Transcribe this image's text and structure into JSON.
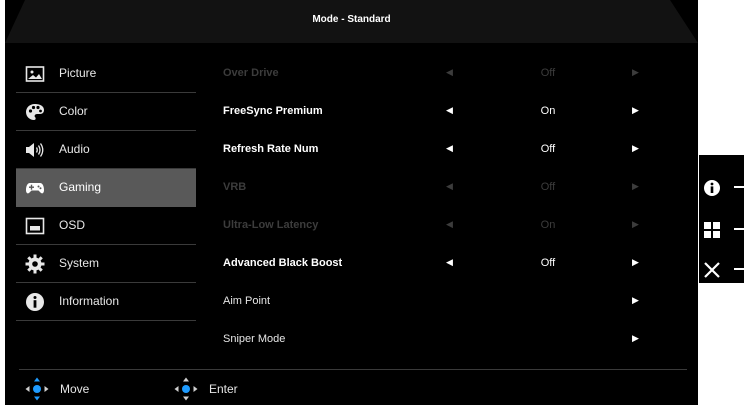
{
  "header": {
    "title": "Mode - Standard"
  },
  "sidebar": {
    "items": [
      {
        "label": "Picture",
        "icon": "picture-icon",
        "active": false
      },
      {
        "label": "Color",
        "icon": "palette-icon",
        "active": false
      },
      {
        "label": "Audio",
        "icon": "speaker-icon",
        "active": false
      },
      {
        "label": "Gaming",
        "icon": "gamepad-icon",
        "active": true
      },
      {
        "label": "OSD",
        "icon": "osd-icon",
        "active": false
      },
      {
        "label": "System",
        "icon": "gear-icon",
        "active": false
      },
      {
        "label": "Information",
        "icon": "info-icon",
        "active": false
      }
    ]
  },
  "menu": {
    "rows": [
      {
        "name": "Over Drive",
        "value": "Off",
        "enabled": false,
        "left_arrow": true
      },
      {
        "name": "FreeSync Premium",
        "value": "On",
        "enabled": true,
        "left_arrow": true
      },
      {
        "name": "Refresh Rate Num",
        "value": "Off",
        "enabled": true,
        "left_arrow": true
      },
      {
        "name": "VRB",
        "value": "Off",
        "enabled": false,
        "left_arrow": true
      },
      {
        "name": "Ultra-Low Latency",
        "value": "On",
        "enabled": false,
        "left_arrow": true
      },
      {
        "name": "Advanced Black Boost",
        "value": "Off",
        "enabled": true,
        "left_arrow": true
      },
      {
        "name": "Aim Point",
        "value": "",
        "enabled": true,
        "left_arrow": false
      },
      {
        "name": "Sniper Mode",
        "value": "",
        "enabled": true,
        "left_arrow": false
      }
    ]
  },
  "footer": {
    "move_label": "Move",
    "enter_label": "Enter"
  },
  "keys": [
    {
      "icon": "info-icon"
    },
    {
      "icon": "menu-grid-icon"
    },
    {
      "icon": "close-icon"
    }
  ],
  "colors": {
    "accent": "#1e9bff",
    "active_bg": "#595959",
    "background": "#000000"
  }
}
